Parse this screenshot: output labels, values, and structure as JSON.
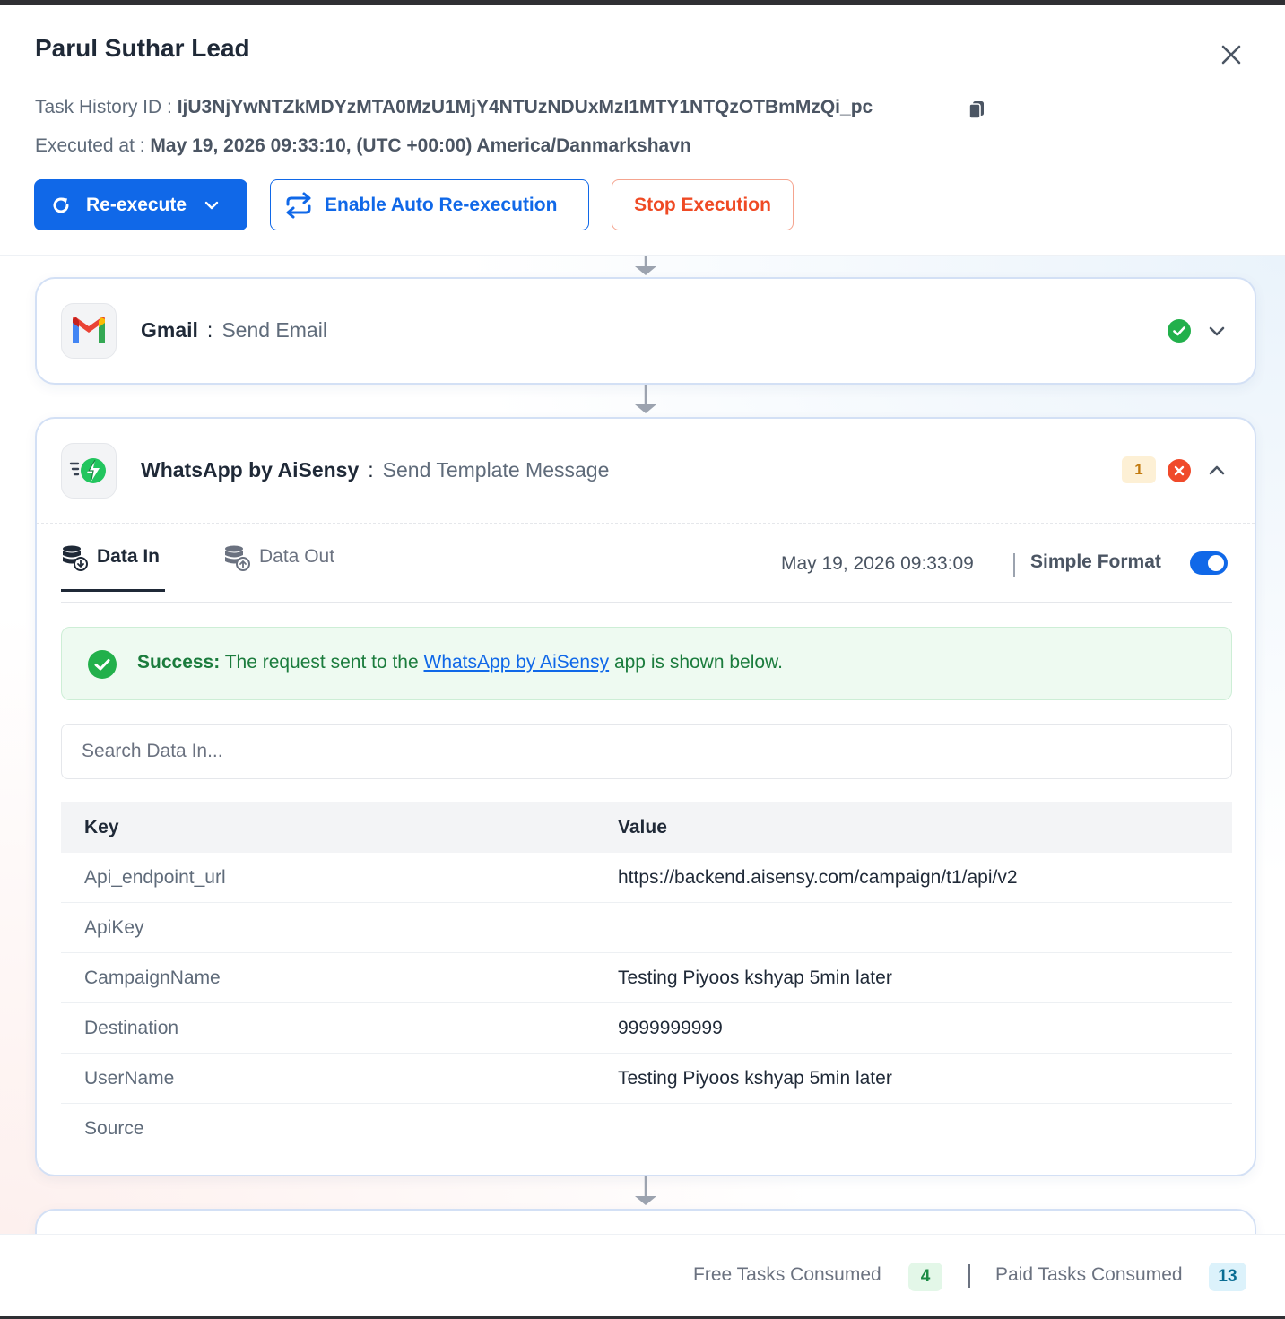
{
  "header": {
    "title": "Parul Suthar Lead",
    "task_history_label": "Task History ID : ",
    "task_history_id": "IjU3NjYwNTZkMDYzMTA0MzU1MjY4NTUzNDUxMzI1MTY1NTQzOTBmMzQi_pc",
    "executed_label": "Executed at : ",
    "executed_value": "May 19, 2026 09:33:10, (UTC +00:00) America/Danmarkshavn"
  },
  "actions": {
    "reexecute": "Re-execute",
    "auto_reexecution": "Enable Auto Re-execution",
    "stop_execution": "Stop Execution"
  },
  "steps": [
    {
      "app": "Gmail",
      "separator": ":",
      "action": "Send Email",
      "status": "success"
    },
    {
      "app": "WhatsApp by AiSensy",
      "separator": ":",
      "action": "Send Template Message",
      "status": "error",
      "count": "1",
      "tabs": {
        "data_in": "Data In",
        "data_out": "Data Out"
      },
      "executed_time": "May 19, 2026 09:33:09",
      "simple_format_label": "Simple Format",
      "simple_format_on": true,
      "success_message": {
        "label": "Success:",
        "text_before": " The request sent to the ",
        "link": "WhatsApp by AiSensy",
        "text_after": " app is shown below."
      },
      "search_placeholder": "Search Data In...",
      "table": {
        "headers": {
          "key": "Key",
          "value": "Value"
        },
        "rows": [
          {
            "key": "Api_endpoint_url",
            "value": "https://backend.aisensy.com/campaign/t1/api/v2"
          },
          {
            "key": "ApiKey",
            "value": ""
          },
          {
            "key": "CampaignName",
            "value": "Testing Piyoos kshyap 5min later"
          },
          {
            "key": "Destination",
            "value": "9999999999"
          },
          {
            "key": "UserName",
            "value": "Testing Piyoos kshyap 5min later"
          },
          {
            "key": "Source",
            "value": ""
          }
        ]
      }
    }
  ],
  "footer": {
    "free_label": "Free Tasks Consumed",
    "free_count": "4",
    "paid_label": "Paid Tasks Consumed",
    "paid_count": "13"
  },
  "colors": {
    "primary": "#1068e8",
    "danger": "#ef4a24",
    "success": "#22b04b",
    "error": "#f04a2b",
    "warning_badge": "#fdf0d5"
  },
  "icons": [
    "close-icon",
    "copy-icon",
    "refresh-icon",
    "chevron-down-icon",
    "repeat-icon",
    "gmail-logo-icon",
    "check-circle-icon",
    "aisensy-logo-icon",
    "error-circle-icon",
    "chevron-up-icon",
    "database-in-icon",
    "database-out-icon",
    "arrow-down-icon"
  ]
}
